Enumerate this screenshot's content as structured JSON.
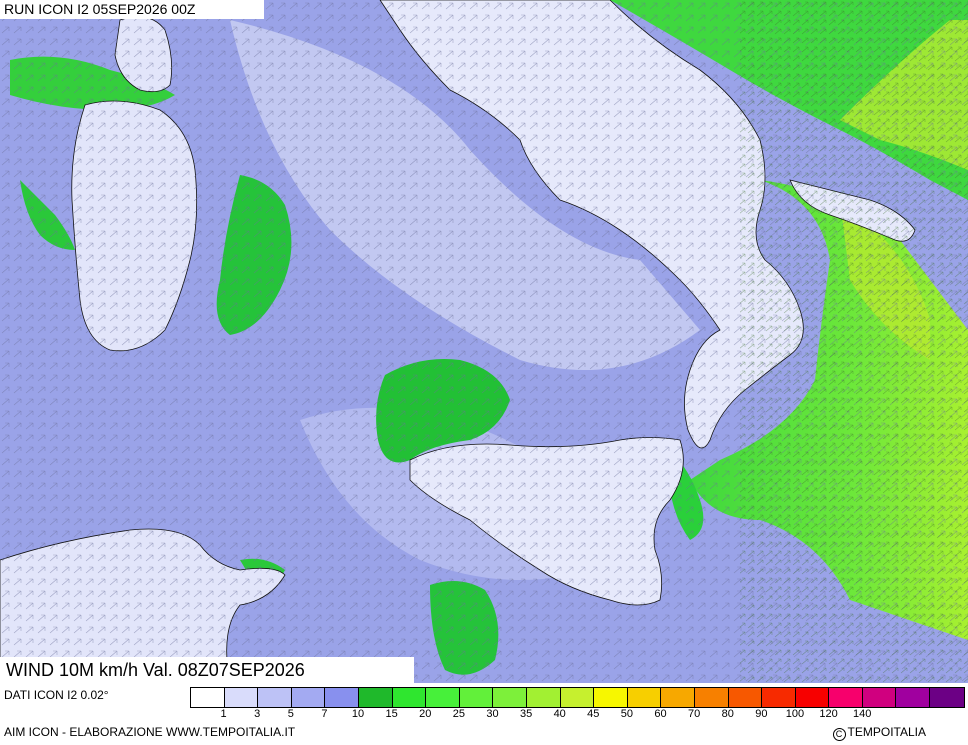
{
  "header": {
    "title": "RUN ICON I2 05SEP2026 00Z"
  },
  "map": {
    "variable_title": "WIND 10M km/h Val. 08Z07SEP2026",
    "colors": {
      "sea_calm": "#9aa3e8",
      "sea_light": "#c7ccf2",
      "land_calm": "#e6e9fb",
      "wind_15": "#3ed83e",
      "wind_25": "#7cf03a",
      "wind_35": "#b6f030",
      "border": "#111111"
    }
  },
  "footer": {
    "dati": "DATI ICON I2 0.02°",
    "elaborazione": "AIM ICON - ELABORAZIONE WWW.TEMPOITALIA.IT",
    "copyright": "TEMPOITALIA"
  },
  "legend": {
    "colors": [
      "#ffffff",
      "#d9dcfb",
      "#bdc2f6",
      "#a3aaf2",
      "#8890ee",
      "#1fb92b",
      "#2fe62f",
      "#47f03a",
      "#62f03a",
      "#7df03a",
      "#a2f032",
      "#c6f02e",
      "#f7f700",
      "#f7cf00",
      "#f7a800",
      "#f78000",
      "#f75800",
      "#f72a00",
      "#f70000",
      "#f7006c",
      "#d0007f",
      "#a0009f",
      "#6c0085"
    ],
    "labels": [
      "1",
      "3",
      "5",
      "7",
      "10",
      "15",
      "20",
      "25",
      "30",
      "35",
      "40",
      "45",
      "50",
      "60",
      "70",
      "80",
      "90",
      "100",
      "120",
      "140"
    ]
  }
}
